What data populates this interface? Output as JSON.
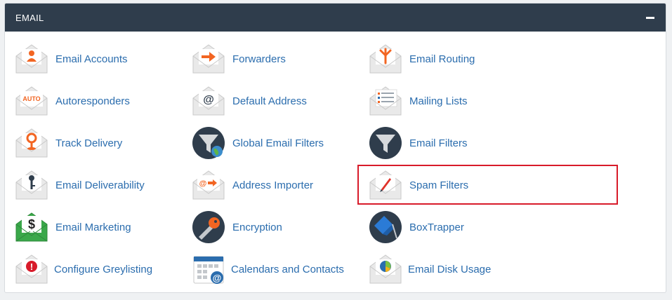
{
  "section": {
    "title": "EMAIL",
    "collapse_icon": "minus-icon"
  },
  "items": [
    {
      "label": "Email Accounts",
      "icon": "email-accounts-icon"
    },
    {
      "label": "Forwarders",
      "icon": "forwarders-icon"
    },
    {
      "label": "Email Routing",
      "icon": "email-routing-icon"
    },
    {
      "label": "Autoresponders",
      "icon": "autoresponders-icon",
      "icon_text": "AUTO"
    },
    {
      "label": "Default Address",
      "icon": "default-address-icon",
      "icon_text": "@"
    },
    {
      "label": "Mailing Lists",
      "icon": "mailing-lists-icon"
    },
    {
      "label": "Track Delivery",
      "icon": "track-delivery-icon"
    },
    {
      "label": "Global Email Filters",
      "icon": "global-email-filters-icon"
    },
    {
      "label": "Email Filters",
      "icon": "email-filters-icon"
    },
    {
      "label": "Email Deliverability",
      "icon": "email-deliverability-icon"
    },
    {
      "label": "Address Importer",
      "icon": "address-importer-icon",
      "icon_text": "@"
    },
    {
      "label": "Spam Filters",
      "icon": "spam-filters-icon",
      "highlighted": true
    },
    {
      "label": "Email Marketing",
      "icon": "email-marketing-icon",
      "icon_text": "$"
    },
    {
      "label": "Encryption",
      "icon": "encryption-icon"
    },
    {
      "label": "BoxTrapper",
      "icon": "boxtrapper-icon"
    },
    {
      "label": "Configure Greylisting",
      "icon": "configure-greylisting-icon",
      "icon_text": "!"
    },
    {
      "label": "Calendars and Contacts",
      "icon": "calendars-and-contacts-icon",
      "icon_text": "@"
    },
    {
      "label": "Email Disk Usage",
      "icon": "email-disk-usage-icon"
    }
  ],
  "colors": {
    "header_bg": "#2f3d4c",
    "link": "#2b6dae",
    "highlight": "#d81b2a",
    "envelope": "#e8e8e8",
    "accent_orange": "#f26522"
  }
}
